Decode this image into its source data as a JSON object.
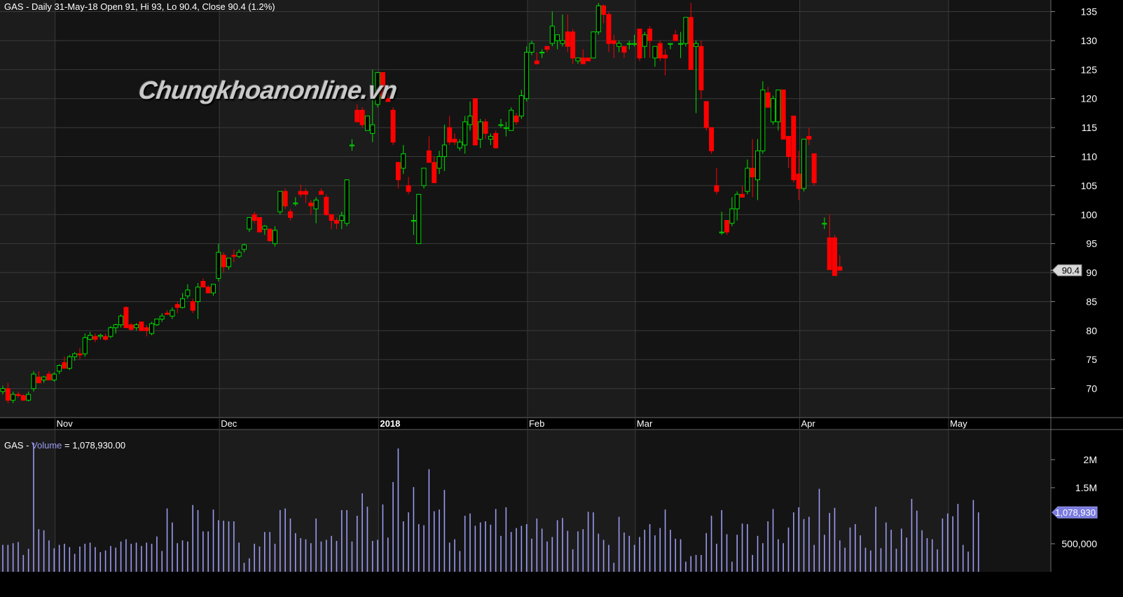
{
  "header": {
    "price_title": "GAS - Daily 31-May-18 Open 91, Hi 93, Lo 90.4, Close 90.4 (1.2%)",
    "volume_prefix": "GAS - ",
    "volume_name": "Volume",
    "volume_value": " = 1,078,930.00"
  },
  "watermark": "Chungkhoanonline.vn",
  "colors": {
    "background": "#000000",
    "pane": "#141414",
    "band": "#1c1c1c",
    "up": "#00e000",
    "down": "#ff0000",
    "volume": "#9a9af0",
    "grid": "#3a3a3a",
    "text": "#ffffff"
  },
  "chart_data": [
    {
      "type": "candlestick",
      "title": "GAS - Daily 31-May-18 Open 91, Hi 93, Lo 90.4, Close 90.4 (1.2%)",
      "ylim": [
        65,
        137
      ],
      "y_ticks": [
        70,
        75,
        80,
        85,
        90,
        95,
        100,
        105,
        110,
        115,
        120,
        125,
        130,
        135
      ],
      "month_labels": [
        {
          "label": "Nov",
          "index": 11
        },
        {
          "label": "Dec",
          "index": 43
        },
        {
          "label": "2018",
          "index": 74,
          "bold": true
        },
        {
          "label": "Feb",
          "index": 103
        },
        {
          "label": "Mar",
          "index": 124
        },
        {
          "label": "Apr",
          "index": 156
        },
        {
          "label": "May",
          "index": 185
        }
      ],
      "last_price": "90.4",
      "candles": [
        [
          69.5,
          70.5,
          69,
          70
        ],
        [
          70,
          71,
          67.5,
          68
        ],
        [
          68,
          69.5,
          67.5,
          69
        ],
        [
          69,
          69.5,
          68.5,
          68.8
        ],
        [
          68.8,
          69,
          68,
          68
        ],
        [
          68,
          69.5,
          67.8,
          69
        ],
        [
          70,
          73,
          69.5,
          72.5
        ],
        [
          72,
          73,
          71,
          71
        ],
        [
          71.5,
          72.2,
          71,
          72
        ],
        [
          72.5,
          73,
          71.5,
          71.5
        ],
        [
          71.5,
          72.8,
          71.2,
          72.5
        ],
        [
          73,
          74.2,
          72.5,
          74
        ],
        [
          74.5,
          75.5,
          73.8,
          73.5
        ],
        [
          73.5,
          75.8,
          73.2,
          75.5
        ],
        [
          75.5,
          76.3,
          74.8,
          76
        ],
        [
          76,
          77,
          75,
          75.8
        ],
        [
          76,
          79.5,
          75.5,
          78.8
        ],
        [
          78.5,
          79.8,
          78.3,
          79.2
        ],
        [
          79,
          79.5,
          78,
          78.5
        ],
        [
          79,
          79.5,
          78.5,
          79.2
        ],
        [
          79,
          79.5,
          78.3,
          78.5
        ],
        [
          79,
          80.8,
          78.7,
          80.5
        ],
        [
          80.5,
          81.2,
          79.5,
          81
        ],
        [
          81,
          82.8,
          80.5,
          82.5
        ],
        [
          84,
          84.2,
          80.5,
          80.5
        ],
        [
          81,
          81.3,
          80,
          80.2
        ],
        [
          80.5,
          81.3,
          80,
          81
        ],
        [
          81.5,
          81.5,
          80,
          80
        ],
        [
          80.5,
          81,
          79,
          80
        ],
        [
          79.5,
          81.5,
          79.2,
          81.2
        ],
        [
          81,
          82,
          80.8,
          82
        ],
        [
          82,
          83,
          81.5,
          82.5
        ],
        [
          83,
          83.5,
          82.7,
          82.8
        ],
        [
          82.5,
          84,
          82,
          83.5
        ],
        [
          84.5,
          85,
          83,
          84
        ],
        [
          84,
          86.5,
          83.8,
          85.5
        ],
        [
          86,
          88,
          85.5,
          87
        ],
        [
          85,
          85.5,
          83,
          83.5
        ],
        [
          85,
          88.2,
          82,
          87.5
        ],
        [
          88.5,
          89,
          87.5,
          87.5
        ],
        [
          87.5,
          87.8,
          86.5,
          86.5
        ],
        [
          86.5,
          88,
          86,
          88
        ],
        [
          89,
          95,
          88.5,
          93.5
        ],
        [
          93,
          93.5,
          90,
          91
        ],
        [
          91,
          92.5,
          90.5,
          92.5
        ],
        [
          93,
          94,
          91.8,
          92.8
        ],
        [
          92.8,
          94,
          92.5,
          93.5
        ],
        [
          94,
          95,
          93.5,
          94.8
        ],
        [
          97.5,
          99.5,
          97,
          99.5
        ],
        [
          100,
          100.5,
          98.5,
          99
        ],
        [
          99.5,
          99.5,
          97,
          97
        ],
        [
          97.5,
          98.2,
          96.5,
          98
        ],
        [
          97.5,
          97.5,
          95.3,
          95.5
        ],
        [
          95,
          98,
          94.5,
          97.3
        ],
        [
          100.5,
          104,
          100,
          104
        ],
        [
          104,
          104.5,
          101,
          101.5
        ],
        [
          100.5,
          101,
          99,
          99.5
        ],
        [
          102,
          103,
          101.5,
          102
        ],
        [
          104,
          105.2,
          103,
          103.5
        ],
        [
          104,
          104.5,
          102,
          103.5
        ],
        [
          102,
          102.5,
          100,
          101.5
        ],
        [
          101,
          103,
          98.5,
          102.5
        ],
        [
          104,
          104.5,
          103.5,
          103.5
        ],
        [
          103,
          103.5,
          99.8,
          100
        ],
        [
          100,
          100,
          97.5,
          99
        ],
        [
          99,
          99.5,
          97.5,
          98.5
        ],
        [
          99,
          100.5,
          97.5,
          99.8
        ],
        [
          98.5,
          106,
          98,
          106
        ],
        [
          112,
          113,
          111,
          112
        ],
        [
          118,
          119,
          116.5,
          116
        ],
        [
          118,
          118.5,
          115,
          115.5
        ],
        [
          114.5,
          117,
          114.5,
          117
        ],
        [
          114,
          125,
          112.5,
          115.5
        ],
        [
          119,
          121,
          118.5,
          124.5
        ],
        [
          124.5,
          124.5,
          120,
          120
        ],
        [
          120,
          121.5,
          119.5,
          119.5
        ],
        [
          118,
          118.5,
          112,
          112.5
        ],
        [
          109,
          109,
          104.5,
          106
        ],
        [
          108,
          112,
          107,
          110.5
        ],
        [
          105,
          106.5,
          103.5,
          104
        ],
        [
          99,
          100,
          96.5,
          99
        ],
        [
          95,
          103.5,
          95,
          103.5
        ],
        [
          105,
          108,
          104.5,
          108
        ],
        [
          111,
          113.5,
          110.5,
          109
        ],
        [
          109,
          110,
          105.5,
          105.5
        ],
        [
          108,
          111,
          107,
          110
        ],
        [
          110,
          115.5,
          107.5,
          112
        ],
        [
          115,
          117,
          112,
          112.5
        ],
        [
          113,
          114,
          112,
          112.5
        ],
        [
          111.5,
          113,
          111,
          112.5
        ],
        [
          112,
          117,
          110.5,
          116
        ],
        [
          115.5,
          119.5,
          114.5,
          117
        ],
        [
          120,
          120,
          112,
          112
        ],
        [
          113,
          116.5,
          111.5,
          116
        ],
        [
          116,
          116.5,
          113,
          114
        ],
        [
          113,
          114,
          112,
          113.5
        ],
        [
          114,
          114.5,
          111.5,
          111.5
        ],
        [
          115.5,
          116.5,
          115,
          115.5
        ],
        [
          115,
          116,
          113.5,
          115
        ],
        [
          114.5,
          118.5,
          114.5,
          118
        ],
        [
          117,
          117.5,
          115.5,
          116
        ],
        [
          117,
          121.5,
          116.5,
          120.5
        ],
        [
          120,
          129,
          119.5,
          128
        ],
        [
          128,
          130,
          127.5,
          129.5
        ],
        [
          126.5,
          128,
          126,
          126
        ],
        [
          128,
          128.5,
          127,
          128
        ],
        [
          129,
          129,
          128,
          128.5
        ],
        [
          129.5,
          135,
          129,
          132.5
        ],
        [
          130,
          131,
          128.5,
          131
        ],
        [
          129.5,
          134.5,
          129,
          130
        ],
        [
          131.5,
          134.5,
          128,
          129
        ],
        [
          131.5,
          132,
          126,
          127
        ],
        [
          126.5,
          127,
          126,
          127
        ],
        [
          127,
          128.5,
          126,
          126
        ],
        [
          127,
          127,
          126.5,
          126.5
        ],
        [
          127,
          131.5,
          127,
          131.5
        ],
        [
          131.5,
          136.5,
          131,
          136
        ],
        [
          136,
          136.2,
          133,
          134.5
        ],
        [
          134.5,
          135,
          128,
          129.5
        ],
        [
          130,
          131,
          127,
          129.5
        ],
        [
          129,
          130,
          128,
          129.5
        ],
        [
          129,
          129,
          127,
          128
        ],
        [
          129.5,
          130,
          128.5,
          129.5
        ],
        [
          129.5,
          131,
          129,
          129.5
        ],
        [
          132,
          132,
          126.5,
          127
        ],
        [
          129,
          131.5,
          127,
          131
        ],
        [
          132,
          132.5,
          127,
          130
        ],
        [
          127,
          128.5,
          125.5,
          129
        ],
        [
          129.5,
          130,
          126.5,
          127
        ],
        [
          127.5,
          128.5,
          124,
          127
        ],
        [
          129.5,
          129.5,
          128.5,
          129.5
        ],
        [
          131,
          131.8,
          130,
          130
        ],
        [
          129.5,
          131.5,
          127,
          129.5
        ],
        [
          129.5,
          134,
          129,
          134
        ],
        [
          134,
          136.5,
          125,
          125
        ],
        [
          129,
          130,
          117.5,
          129.5
        ],
        [
          129,
          130,
          120,
          121.5
        ],
        [
          119.5,
          119.5,
          114.5,
          115
        ],
        [
          115,
          115,
          110.5,
          111
        ],
        [
          105,
          108,
          103.5,
          104
        ],
        [
          97,
          100.5,
          96.5,
          97
        ],
        [
          99,
          99,
          96.5,
          97
        ],
        [
          98.5,
          103,
          98,
          101
        ],
        [
          101,
          104,
          99,
          103.5
        ],
        [
          103.5,
          105,
          103.5,
          103
        ],
        [
          104,
          109.5,
          103.5,
          108
        ],
        [
          108,
          113,
          103,
          106.5
        ],
        [
          106,
          113,
          102.5,
          111
        ],
        [
          111,
          123,
          110.5,
          121.5
        ],
        [
          121,
          122,
          119.5,
          118.5
        ],
        [
          116,
          120.5,
          115.5,
          120
        ],
        [
          116,
          121,
          114.5,
          121.5
        ],
        [
          121.5,
          121.5,
          113,
          113
        ],
        [
          113.5,
          113.5,
          108,
          110
        ],
        [
          117,
          117,
          105.5,
          106
        ],
        [
          107,
          111,
          102.5,
          104.5
        ],
        [
          104.5,
          113,
          104,
          113
        ],
        [
          113.5,
          115,
          112,
          113
        ],
        [
          110.5,
          110.5,
          105,
          105.5
        ],
        [
          0,
          0,
          0,
          0
        ],
        [
          98.5,
          99.5,
          97.5,
          98.5
        ],
        [
          96,
          100,
          96,
          90.5
        ],
        [
          96,
          96.5,
          89.5,
          89.5
        ],
        [
          91,
          93,
          90.4,
          90.4
        ]
      ]
    },
    {
      "type": "bar",
      "series_name": "Volume",
      "ylim": [
        0,
        2400000
      ],
      "y_ticks": [
        {
          "value": 500000,
          "label": "500,000"
        },
        {
          "value": 1500000,
          "label": "1.5M"
        },
        {
          "value": 2000000,
          "label": "2M"
        }
      ],
      "last_value": "1,078,930",
      "values": [
        480000,
        480000,
        510000,
        530000,
        300000,
        410000,
        2300000,
        760000,
        740000,
        560000,
        420000,
        480000,
        500000,
        440000,
        320000,
        450000,
        500000,
        520000,
        440000,
        350000,
        380000,
        460000,
        430000,
        540000,
        580000,
        500000,
        520000,
        460000,
        520000,
        500000,
        630000,
        370000,
        1130000,
        880000,
        510000,
        560000,
        540000,
        1190000,
        1100000,
        720000,
        720000,
        1110000,
        920000,
        910000,
        900000,
        900000,
        520000,
        160000,
        240000,
        500000,
        450000,
        710000,
        710000,
        500000,
        1100000,
        1130000,
        950000,
        690000,
        600000,
        580000,
        510000,
        950000,
        540000,
        570000,
        640000,
        550000,
        1100000,
        1100000,
        540000,
        1000000,
        1400000,
        1160000,
        550000,
        570000,
        1200000,
        610000,
        1600000,
        2200000,
        900000,
        1060000,
        1510000,
        850000,
        830000,
        1830000,
        1080000,
        1110000,
        1460000,
        520000,
        580000,
        370000,
        1000000,
        1040000,
        820000,
        880000,
        900000,
        840000,
        1120000,
        640000,
        1150000,
        710000,
        780000,
        820000,
        850000,
        590000,
        950000,
        770000,
        540000,
        620000,
        920000,
        960000,
        730000,
        400000,
        720000,
        760000,
        1070000,
        1060000,
        680000,
        570000,
        480000,
        160000,
        980000,
        700000,
        640000,
        480000,
        620000,
        750000,
        850000,
        650000,
        780000,
        1110000,
        750000,
        590000,
        580000,
        180000,
        280000,
        300000,
        300000,
        690000,
        1000000,
        500000,
        1100000,
        670000,
        180000,
        660000,
        860000,
        850000,
        300000,
        640000,
        510000,
        900000,
        1120000,
        580000,
        510000,
        790000,
        1060000,
        1150000,
        940000,
        980000,
        480000,
        1480000,
        660000,
        1050000,
        1140000,
        560000,
        430000,
        790000,
        850000,
        650000,
        430000,
        380000,
        1160000,
        420000,
        880000,
        750000,
        410000,
        770000,
        610000,
        1300000,
        1090000,
        740000,
        600000,
        580000,
        400000,
        950000,
        1040000,
        990000,
        1210000,
        480000,
        360000,
        1280000,
        1060000
      ]
    }
  ]
}
